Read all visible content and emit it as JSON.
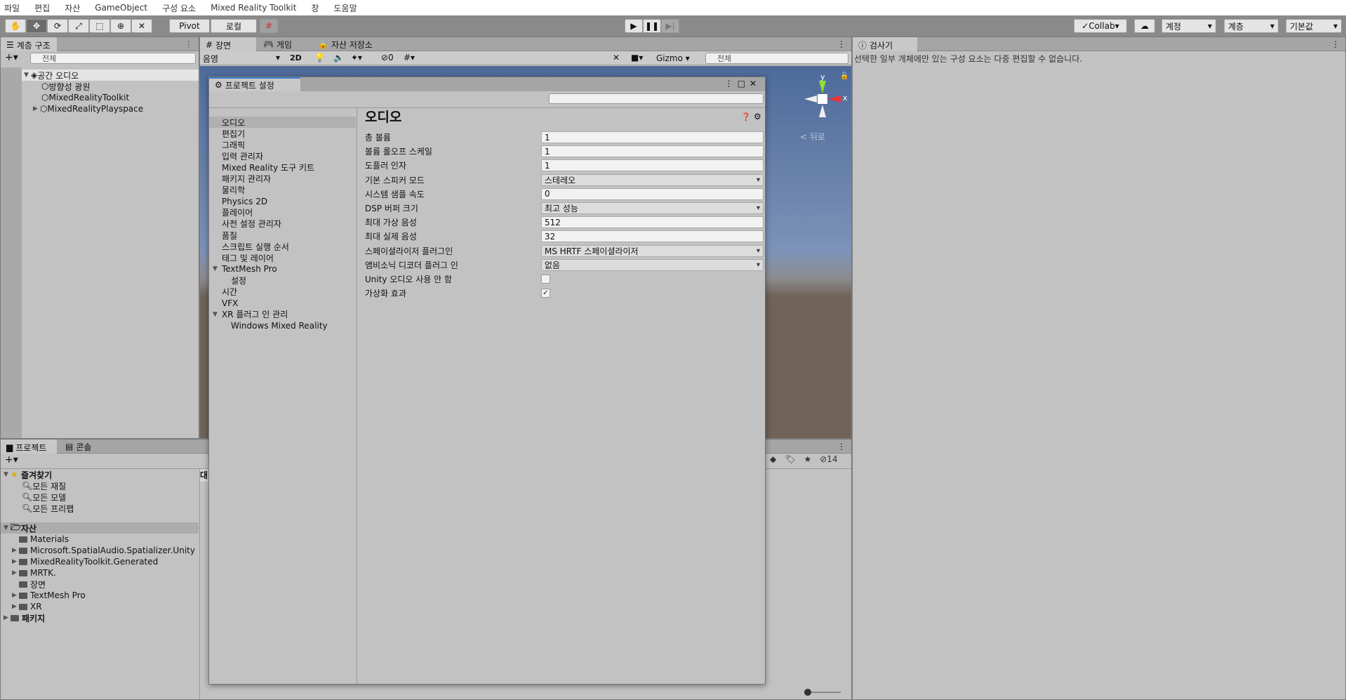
{
  "menu": [
    "파일",
    "편집",
    "자산",
    "GameObject",
    "구성 요소",
    "Mixed Reality Toolkit",
    "창",
    "도움말"
  ],
  "toolbar": {
    "pivot": "Pivot",
    "local": "로컬",
    "collab": "Collab",
    "account": "계정",
    "layers": "계층",
    "layout": "기본값"
  },
  "hierarchy": {
    "tab": "계층 구조",
    "search_placeholder": "전체",
    "scene": "공간 오디오",
    "items": [
      "방향성 광원",
      "MixedRealityToolkit",
      "MixedRealityPlayspace"
    ]
  },
  "scene": {
    "tabs": [
      "장면",
      "게임",
      "자산 저장소"
    ],
    "shading": "음영",
    "mode2d": "2D",
    "hidden_count": "0",
    "gizmo": "Gizmo",
    "search_placeholder": "전체",
    "back": "< 뒤로",
    "axis_y": "y",
    "axis_x": "x"
  },
  "inspector": {
    "tab": "검사기",
    "message": "선택한 일부 개체에만 있는 구성 요소는 다중 편집할 수 없습니다."
  },
  "project": {
    "tabs": [
      "프로젝트",
      "콘솔"
    ],
    "favorites": "즐겨찾기",
    "fav_items": [
      "모든 재질",
      "모든 모델",
      "모든 프리팹"
    ],
    "assets": "자산",
    "asset_items": [
      {
        "name": "Materials",
        "exp": false
      },
      {
        "name": "Microsoft.SpatialAudio.Spatializer.Unity",
        "exp": true
      },
      {
        "name": "MixedRealityToolkit.Generated",
        "exp": true
      },
      {
        "name": "MRTK.",
        "exp": true
      },
      {
        "name": "장면",
        "exp": false
      },
      {
        "name": "TextMesh Pro",
        "exp": true
      },
      {
        "name": "XR",
        "exp": true
      }
    ],
    "packages": "패키지",
    "right_partial": "대",
    "hidden_count": "14"
  },
  "settings": {
    "title": "프로젝트 설정",
    "nav": [
      "오디오",
      "편집기",
      "그래픽",
      "입력 관리자",
      "Mixed Reality 도구 키트",
      "패키지 관리자",
      "물리학",
      "Physics 2D",
      "플레이어",
      "사전 설정 관리자",
      "품질",
      "스크립트 실행 순서",
      "태그 및 레이어",
      "TextMesh Pro",
      "설정",
      "시간",
      "VFX",
      "XR 플러그 인 관리",
      "Windows Mixed Reality"
    ],
    "heading": "오디오",
    "fields": [
      {
        "label": "총 볼륨",
        "value": "1",
        "type": "text"
      },
      {
        "label": "볼륨 롤오프 스케일",
        "value": "1",
        "type": "text"
      },
      {
        "label": "도플러 인자",
        "value": "1",
        "type": "text"
      },
      {
        "label": "기본 스피커 모드",
        "value": "스테레오",
        "type": "drop"
      },
      {
        "label": "시스템 샘플 속도",
        "value": "0",
        "type": "text"
      },
      {
        "label": "DSP 버퍼 크기",
        "value": "최고 성능",
        "type": "drop"
      },
      {
        "label": "최대 가상 음성",
        "value": "512",
        "type": "text"
      },
      {
        "label": "최대 실제 음성",
        "value": "32",
        "type": "text"
      },
      {
        "label": "스페이셜라이저 플러그인",
        "value": "MS HRTF 스페이셜라이저",
        "type": "drop"
      },
      {
        "label": "앰비소닉 디코더 플러그 인",
        "value": "없음",
        "type": "drop"
      },
      {
        "label": "Unity 오디오 사용 안 함",
        "value": false,
        "type": "check"
      },
      {
        "label": "가상화 효과",
        "value": true,
        "type": "check"
      }
    ]
  },
  "colors": {
    "sky": "#5b7bab",
    "ground": "#6f6359",
    "selected": "#b0b0b0"
  }
}
